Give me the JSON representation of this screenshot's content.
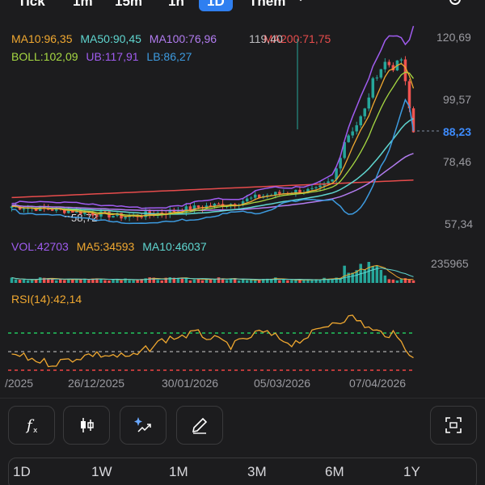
{
  "header": {
    "timeframes": [
      "Tick",
      "1m",
      "15m",
      "1h",
      "1D",
      "Thêm"
    ],
    "active": "1D",
    "more_chevron": "chevron-down-icon",
    "settings_icon": "gear-icon"
  },
  "price_panel": {
    "ma_legend": [
      {
        "text": "MA10:96,35",
        "color": "#f0a830"
      },
      {
        "text": "MA50:90,45",
        "color": "#5fd6d0"
      },
      {
        "text": "MA100:76,96",
        "color": "#b27cf0"
      },
      {
        "text": "MA200:71,75",
        "color": "#e74c4c"
      }
    ],
    "ma_overlap_text": "119,40",
    "boll_legend": [
      {
        "text": "BOLL:102,09",
        "color": "#a6d842"
      },
      {
        "text": "UB:117,91",
        "color": "#a05cf0"
      },
      {
        "text": "LB:86,27",
        "color": "#3d9be0"
      }
    ],
    "axis": [
      "120,69",
      "99,57",
      "78,46",
      "57,34"
    ],
    "last_price": "88,23",
    "low_annotation": "58,72",
    "colors": {
      "up": "#26a69a",
      "down": "#ef5350"
    }
  },
  "volume_panel": {
    "legend": [
      {
        "text": "VOL:42703",
        "color": "#a05cf0"
      },
      {
        "text": "MA5:34593",
        "color": "#f0a830"
      },
      {
        "text": "MA10:46037",
        "color": "#5fd6d0"
      }
    ],
    "axis_max": "235965"
  },
  "rsi_panel": {
    "legend": {
      "text": "RSI(14):42,14",
      "color": "#f0a830"
    },
    "upper_color": "#22c55e",
    "lower_color": "#ef4444"
  },
  "dates": [
    "/2025",
    "26/12/2025",
    "30/01/2026",
    "05/03/2026",
    "07/04/2026"
  ],
  "toolbar": [
    {
      "name": "indicator-button",
      "icon": "function-icon"
    },
    {
      "name": "chart-type-button",
      "icon": "candlestick-icon"
    },
    {
      "name": "ai-analysis-button",
      "icon": "sparkle-chart-icon"
    },
    {
      "name": "draw-button",
      "icon": "pencil-icon"
    },
    {
      "name": "fullscreen-button",
      "icon": "expand-icon"
    }
  ],
  "ranges": [
    "1D",
    "1W",
    "1M",
    "3M",
    "6M",
    "1Y"
  ]
}
